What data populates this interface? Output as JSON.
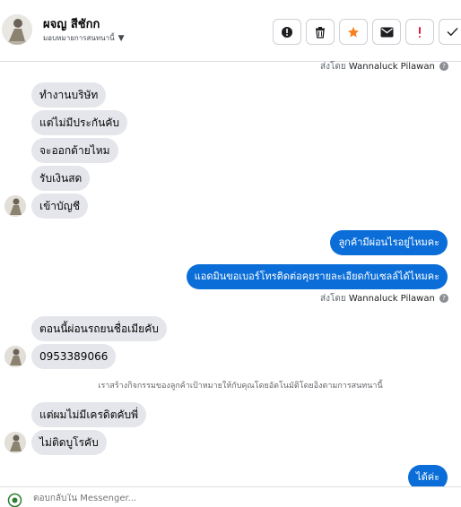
{
  "header": {
    "name": "ผจญ สีชักก",
    "assign_label": "มอบหมายการสนทนานี้"
  },
  "messages": {
    "sent_by_prefix": "ส่งโดย",
    "sent_by_name": "Wannaluck Pilawan",
    "incoming_group1": [
      "ทำงานบริษัท",
      "แต่ไม่มีประกันคับ",
      "จะออกด้ายไหม",
      "รับเงินสด",
      "เข้าบัญชี"
    ],
    "outgoing_group1": [
      "ลูกค้ามีผ่อนไรอยู่ไหมคะ",
      "แอดมินขอเบอร์โทรติดต่อคุยรายละเอียดกับเซลล์ได้ไหมคะ"
    ],
    "incoming_group2": [
      "ตอนนี้ผ่อนรถยนชื่อเมียคับ",
      "0953389066"
    ],
    "system_note": "เราสร้างกิจกรรมของลูกค้าเป้าหมายให้กับคุณโดยอัตโนมัติโดยอิงตามการสนทนานี้",
    "incoming_group3": [
      "แต่ผมไม่มีเครดิตคับพี่",
      "ไม่ติดบูโรคับ"
    ],
    "outgoing_partial": "ได้ค่ะ"
  },
  "composer": {
    "placeholder": "ตอบกลับใน Messenger..."
  },
  "colors": {
    "outgoing_bubble": "#0b6ed8",
    "incoming_bubble": "#e4e6eb",
    "star": "#f7811f",
    "alert": "#e41e3f"
  },
  "icons": [
    "info-icon",
    "trash-icon",
    "star-icon",
    "mail-icon",
    "exclamation-icon",
    "checkmark-icon"
  ]
}
